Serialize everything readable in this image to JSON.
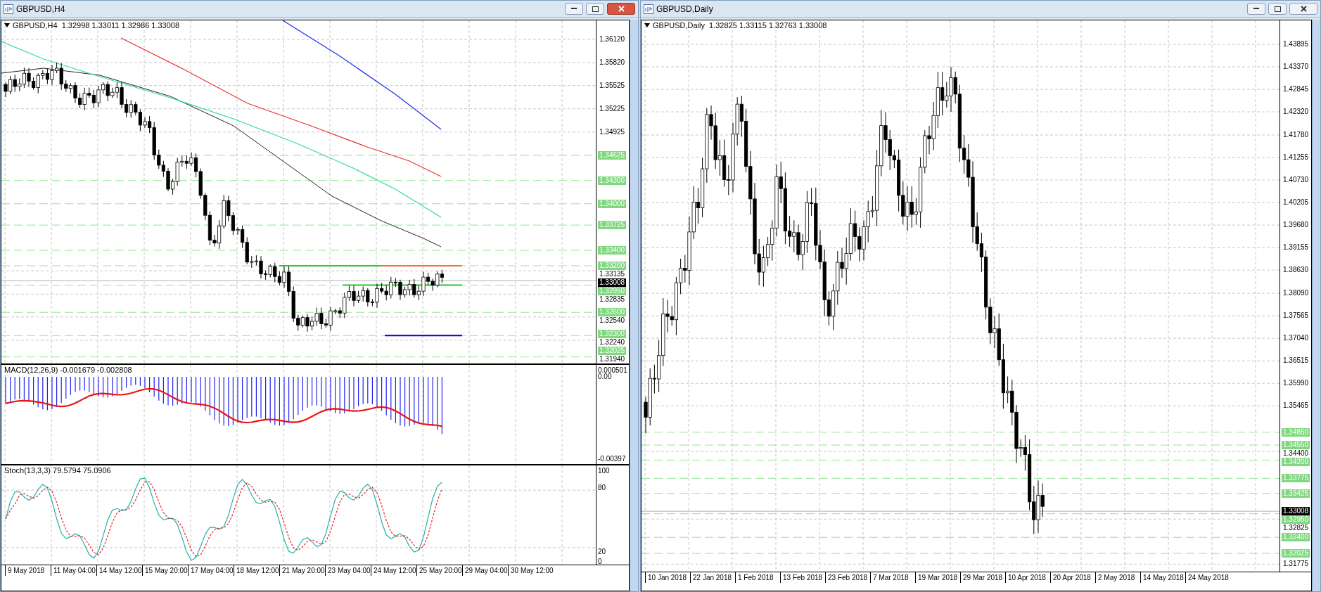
{
  "windows": [
    {
      "title": "GBPUSD,H4",
      "active": true,
      "header": "GBPUSD,H4  1.32998 1.33011 1.32986 1.33008",
      "price_axis": {
        "ticks": [
          "1.36120",
          "1.35820",
          "1.35525",
          "1.35225",
          "1.34925",
          "1.33135",
          "1.32835",
          "1.32540",
          "1.32240",
          "1.31940"
        ],
        "levels": [
          "1.34625",
          "1.34300",
          "1.34000",
          "1.33725",
          "1.33400",
          "1.33200",
          "1.32950",
          "1.32600",
          "1.32300",
          "1.32025"
        ],
        "current": "1.33008"
      },
      "indicators": [
        {
          "kind": "macd",
          "label": "MACD(12,26,9) -0.001679 -0.002808",
          "axis": [
            "0.000501",
            "0.00",
            "-0.00397"
          ]
        },
        {
          "kind": "stochastic",
          "label": "Stoch(13,3,3) 79.5794 75.0906",
          "axis": [
            "100",
            "80",
            "20",
            "0"
          ]
        }
      ],
      "time_axis": [
        "9 May 2018",
        "11 May 04:00",
        "14 May 12:00",
        "15 May 20:00",
        "17 May 04:00",
        "18 May 12:00",
        "21 May 20:00",
        "23 May 04:00",
        "24 May 12:00",
        "25 May 20:00",
        "29 May 04:00",
        "30 May 12:00"
      ]
    },
    {
      "title": "GBPUSD,Daily",
      "active": false,
      "header": "GBPUSD,Daily  1.32825 1.33115 1.32763 1.33008",
      "price_axis": {
        "ticks": [
          "1.43895",
          "1.43370",
          "1.42845",
          "1.42320",
          "1.41780",
          "1.41255",
          "1.40730",
          "1.40205",
          "1.39680",
          "1.39155",
          "1.38630",
          "1.38090",
          "1.37565",
          "1.37040",
          "1.36515",
          "1.35990",
          "1.35465",
          "1.34400",
          "1.32825",
          "1.31775"
        ],
        "levels": [
          "1.34850",
          "1.34550",
          "1.34200",
          "1.33775",
          "1.33425",
          "1.32950",
          "1.32400",
          "1.32025"
        ],
        "current": "1.33008"
      },
      "time_axis": [
        "10 Jan 2018",
        "22 Jan 2018",
        "1 Feb 2018",
        "13 Feb 2018",
        "23 Feb 2018",
        "7 Mar 2018",
        "19 Mar 2018",
        "29 Mar 2018",
        "10 Apr 2018",
        "20 Apr 2018",
        "2 May 2018",
        "14 May 2018",
        "24 May 2018"
      ]
    }
  ]
}
